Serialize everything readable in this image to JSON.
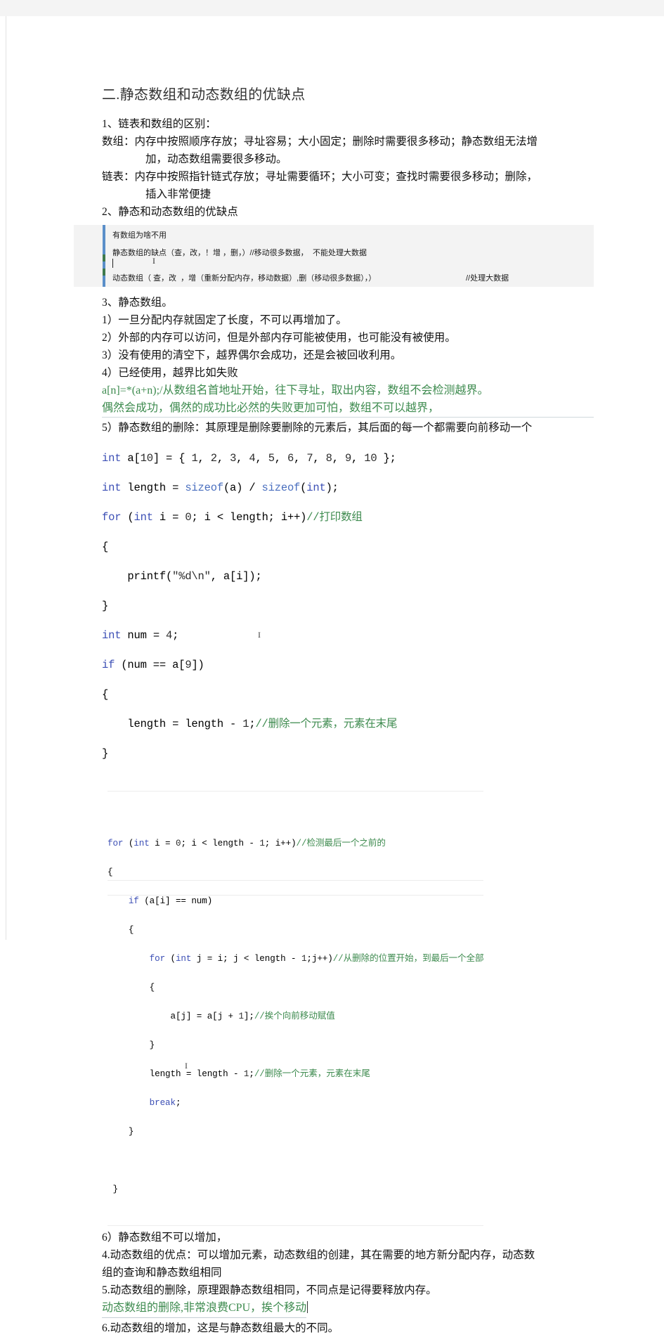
{
  "document": {
    "heading": "二.静态数组和动态数组的优缺点",
    "section1": {
      "title": "1、链表和数组的区别：",
      "array_line1": "数组：内存中按照顺序存放；寻址容易；大小固定；删除时需要很多移动；静态数组无法增",
      "array_line2": "加，动态数组需要很多移动。",
      "list_line1": "链表：内存中按照指针链式存放；寻址需要循环；大小可变；查找时需要很多移动；删除，",
      "list_line2": "插入非常便捷"
    },
    "section2": {
      "title": "2、静态和动态数组的优缺点",
      "editor_shot": {
        "line1": "有数组为啥不用",
        "line2": "静态数组的缺点（查，改，！增 ，删，）//移动很多数据，",
        "line2_tail": "不能处理大数据",
        "line3": "动态数组（ 查，改  ，增（重新分配内存，移动数据）,删（移动很多数据），）",
        "line3_tail": "//处理大数据",
        "marker_color": "#5b8fc9",
        "background_color": "#f3f3f3"
      }
    },
    "section3": {
      "title": "3、静态数组。",
      "items": [
        "1）一旦分配内存就固定了长度，不可以再增加了。",
        "2）外部的内存可以访问，但是外部内存可能被使用，也可能没有被使用。",
        "3）没有使用的清空下，越界偶尔会成功，还是会被回收利用。",
        "4）已经使用，越界比如失败"
      ],
      "green_note_line1": "a[n]=*(a+n);/从数组名首地址开始，往下寻址，取出内容，数组不会检测越界。",
      "green_note_line2": "偶然会成功，偶然的成功比必然的失败更加可怕，数组不可以越界，",
      "item5": "5）静态数组的删除：其原理是删除要删除的元素后，其后面的每一个都需要向前移动一个",
      "item6": "6）静态数组不可以增加，"
    },
    "code_main": {
      "lines": [
        "int a[10] = { 1, 2, 3, 4, 5, 6, 7, 8, 9, 10 };",
        "int length = sizeof(a) / sizeof(int);",
        "for (int i = 0; i < length; i++)//打印数组",
        "{",
        "    printf(\"%d\\n\", a[i]);",
        "}",
        "int num = 4;",
        "if (num == a[9])",
        "{",
        "    length = length - 1;//删除一个元素，元素在末尾",
        "}"
      ]
    },
    "code_box": {
      "lines": [
        "for (int i = 0; i < length - 1; i++)//检测最后一个之前的",
        "{",
        "    if (a[i] == num)",
        "    {",
        "        for (int j = i; j < length - 1;j++)//从删除的位置开始，到最后一个全部",
        "        {",
        "            a[j] = a[j + 1];//挨个向前移动赋值",
        "        }",
        "        length = length - 1;//删除一个元素，元素在末尾",
        "        break;",
        "    }",
        "",
        " }"
      ]
    },
    "section4": {
      "line1": "4.动态数组的优点：可以增加元素，动态数组的创建，其在需要的地方新分配内存，动态数",
      "line2": "组的查询和静态数组相同"
    },
    "section5": {
      "line1": "5.动态数组的删除，原理跟静态数组相同，不同点是记得要释放内存。",
      "green_note": "动态数组的删除,非常浪费CPU，挨个移动"
    },
    "section6": {
      "line1": "6.动态数组的增加，这是与静态数组最大的不同。"
    },
    "colors": {
      "green_text": "#3e8b4f",
      "keyword_blue": "#3c4fb5",
      "heading": "#333333",
      "editor_marker": "#5b8fc9"
    }
  }
}
